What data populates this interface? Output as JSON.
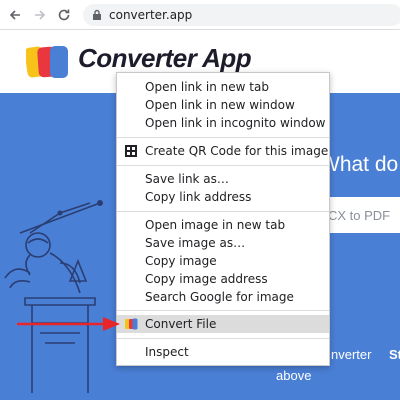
{
  "browser": {
    "url": "converter.app",
    "icons": {
      "back": "arrow-left-icon",
      "forward": "arrow-right-icon",
      "reload": "reload-icon",
      "security": "lock-icon"
    }
  },
  "site": {
    "brand": "Converter App",
    "logo": "converter-app-logo"
  },
  "hero": {
    "heading": "What do y",
    "input_placeholder": "CX to PDF",
    "line1a": "nverter",
    "line1b": "St",
    "line2": "above",
    "background": "#4a7fd6"
  },
  "context_menu": {
    "group1": [
      "Open link in new tab",
      "Open link in new window",
      "Open link in incognito window"
    ],
    "qr": "Create QR Code for this image",
    "group2": [
      "Save link as…",
      "Copy link address"
    ],
    "group3": [
      "Open image in new tab",
      "Save image as…",
      "Copy image",
      "Copy image address",
      "Search Google for image"
    ],
    "convert": "Convert File",
    "inspect": "Inspect"
  },
  "colors": {
    "arrow": "#e8262a",
    "highlight": "#dcdcdc"
  }
}
